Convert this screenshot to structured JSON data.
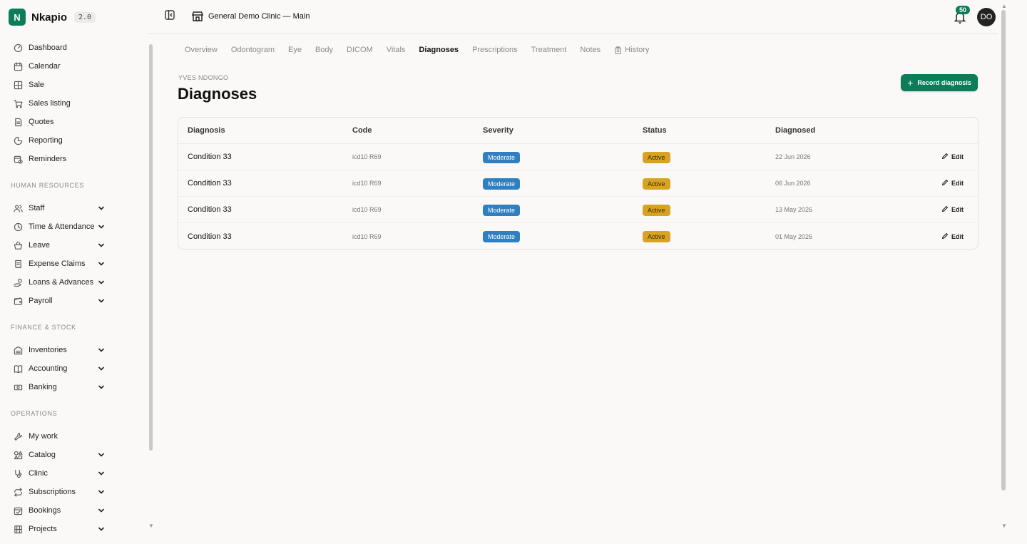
{
  "brand": {
    "logo_letter": "N",
    "name": "Nkapio",
    "version": "2.0",
    "accent": "#0c7c59"
  },
  "sidebar": {
    "main": [
      {
        "label": "Dashboard",
        "icon": "gauge-icon"
      },
      {
        "label": "Calendar",
        "icon": "calendar-icon"
      },
      {
        "label": "Sale",
        "icon": "grid-icon"
      },
      {
        "label": "Sales listing",
        "icon": "cart-icon"
      },
      {
        "label": "Quotes",
        "icon": "document-icon"
      },
      {
        "label": "Reporting",
        "icon": "pie-chart-icon"
      },
      {
        "label": "Reminders",
        "icon": "calendar-clock-icon"
      }
    ],
    "sections": [
      {
        "title": "HUMAN RESOURCES",
        "items": [
          {
            "label": "Staff",
            "icon": "users-icon"
          },
          {
            "label": "Time & Attendance",
            "icon": "clock-icon"
          },
          {
            "label": "Leave",
            "icon": "basket-icon"
          },
          {
            "label": "Expense Claims",
            "icon": "receipt-icon"
          },
          {
            "label": "Loans & Advances",
            "icon": "hand-coins-icon"
          },
          {
            "label": "Payroll",
            "icon": "wallet-icon"
          }
        ]
      },
      {
        "title": "FINANCE & STOCK",
        "items": [
          {
            "label": "Inventories",
            "icon": "warehouse-icon"
          },
          {
            "label": "Accounting",
            "icon": "book-icon"
          },
          {
            "label": "Banking",
            "icon": "banknote-icon"
          }
        ]
      },
      {
        "title": "OPERATIONS",
        "items": [
          {
            "label": "My work",
            "icon": "wrench-icon"
          },
          {
            "label": "Catalog",
            "icon": "shapes-icon"
          },
          {
            "label": "Clinic",
            "icon": "stethoscope-icon"
          },
          {
            "label": "Subscriptions",
            "icon": "repeat-icon"
          },
          {
            "label": "Bookings",
            "icon": "calendar-check-icon"
          },
          {
            "label": "Projects",
            "icon": "building-icon"
          }
        ]
      }
    ]
  },
  "header": {
    "clinic": "General Demo Clinic — Main",
    "notifications": "50",
    "avatar_initials": "DO"
  },
  "tabs": [
    "Overview",
    "Odontogram",
    "Eye",
    "Body",
    "DICOM",
    "Vitals",
    "Diagnoses",
    "Prescriptions",
    "Treatment",
    "Notes",
    "History"
  ],
  "active_tab": "Diagnoses",
  "page": {
    "patient": "YVES NDONGO",
    "title": "Diagnoses",
    "record_button": "Record diagnosis"
  },
  "table": {
    "columns": [
      "Diagnosis",
      "Code",
      "Severity",
      "Status",
      "Diagnosed"
    ],
    "action_label": "Edit",
    "rows": [
      {
        "diagnosis": "Condition 33",
        "code": "icd10 R69",
        "severity": "Moderate",
        "status": "Active",
        "date": "22 Jun 2026"
      },
      {
        "diagnosis": "Condition 33",
        "code": "icd10 R69",
        "severity": "Moderate",
        "status": "Active",
        "date": "06 Jun 2026"
      },
      {
        "diagnosis": "Condition 33",
        "code": "icd10 R69",
        "severity": "Moderate",
        "status": "Active",
        "date": "13 May 2026"
      },
      {
        "diagnosis": "Condition 33",
        "code": "icd10 R69",
        "severity": "Moderate",
        "status": "Active",
        "date": "01 May 2026"
      }
    ]
  },
  "colors": {
    "severity_badge": "#2f7fc1",
    "status_badge": "#d9a322"
  }
}
